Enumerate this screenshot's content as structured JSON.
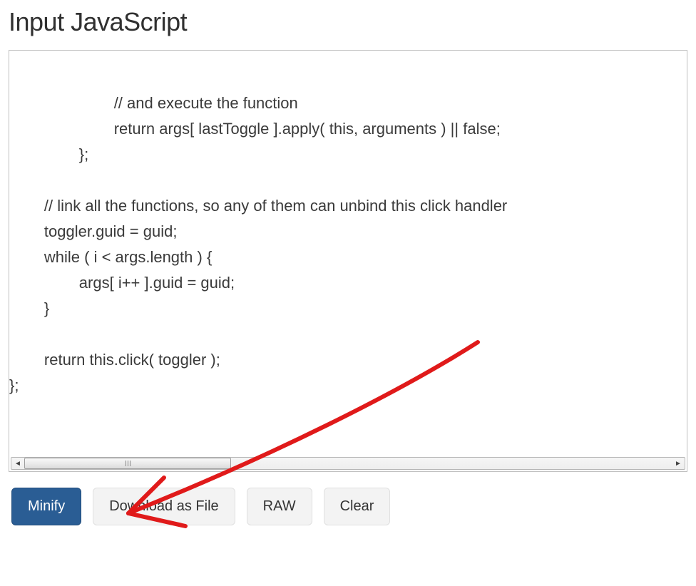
{
  "heading": "Input JavaScript",
  "code_lines": [
    "                        // and execute the function",
    "                        return args[ lastToggle ].apply( this, arguments ) || false;",
    "                };",
    "",
    "        // link all the functions, so any of them can unbind this click handler",
    "        toggler.guid = guid;",
    "        while ( i < args.length ) {",
    "                args[ i++ ].guid = guid;",
    "        }",
    "",
    "        return this.click( toggler );",
    "};"
  ],
  "buttons": {
    "minify": "Minify",
    "download": "Download as File",
    "raw": "RAW",
    "clear": "Clear"
  },
  "arrow_color": "#e01a1a"
}
